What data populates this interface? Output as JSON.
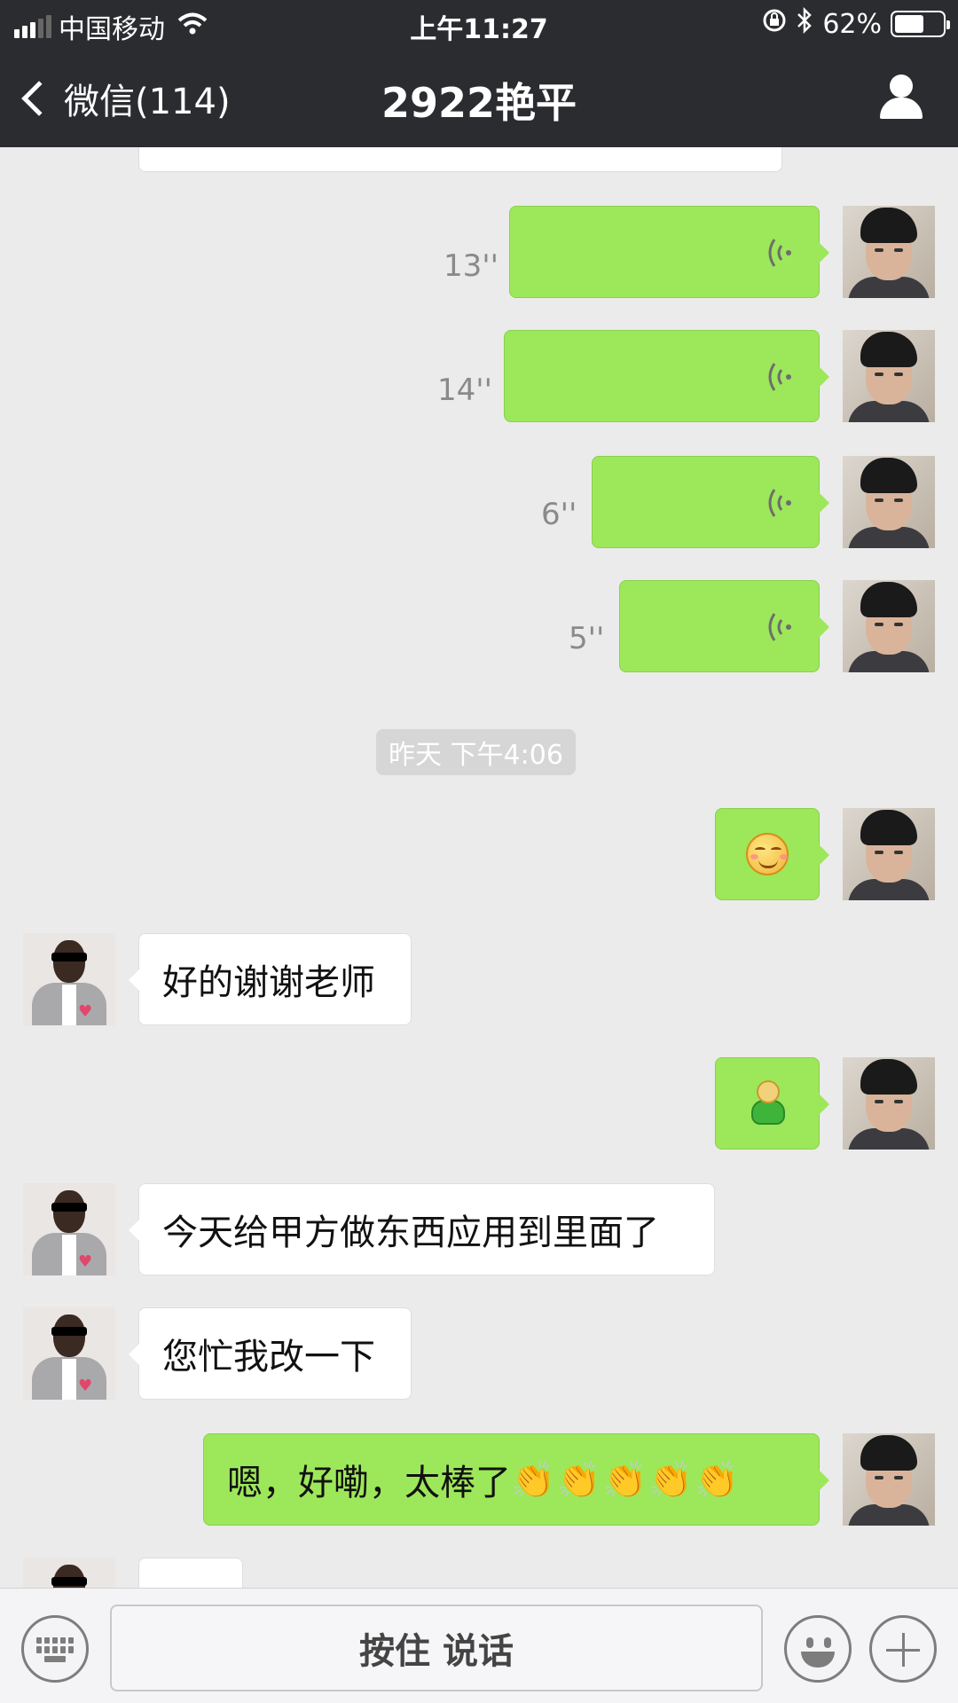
{
  "status_bar": {
    "carrier": "中国移动",
    "time": "上午11:27",
    "battery": "62%",
    "battery_level": 0.62
  },
  "nav": {
    "back_label": "微信(114)",
    "title": "2922艳平",
    "icons": {
      "back": "chevron-left-icon",
      "profile": "person-icon"
    }
  },
  "messages": [
    {
      "side": "right",
      "type": "voice",
      "duration": "13''"
    },
    {
      "side": "right",
      "type": "voice",
      "duration": "14''"
    },
    {
      "side": "right",
      "type": "voice",
      "duration": "6''"
    },
    {
      "side": "right",
      "type": "voice",
      "duration": "5''"
    },
    {
      "type": "timestamp",
      "text": "昨天 下午4:06"
    },
    {
      "side": "right",
      "type": "emoji",
      "emoji": "smirk-face"
    },
    {
      "side": "left",
      "type": "text",
      "text": "好的谢谢老师"
    },
    {
      "side": "right",
      "type": "emoji",
      "emoji": "pig-sticker"
    },
    {
      "side": "left",
      "type": "text",
      "text": "今天给甲方做东西应用到里面了"
    },
    {
      "side": "left",
      "type": "text",
      "text": "您忙我改一下"
    },
    {
      "side": "right",
      "type": "text",
      "text": "嗯，好嘞，太棒了",
      "suffix": "👏👏👏👏👏"
    }
  ],
  "input_bar": {
    "talk_label": "按住 说话",
    "icons": {
      "keyboard": "keyboard-icon",
      "emoji": "smiley-icon",
      "plus": "plus-icon"
    }
  },
  "colors": {
    "header_bg": "#2b2c30",
    "chat_bg": "#ebebeb",
    "sent_bubble": "#9de85a",
    "received_bubble": "#ffffff"
  }
}
